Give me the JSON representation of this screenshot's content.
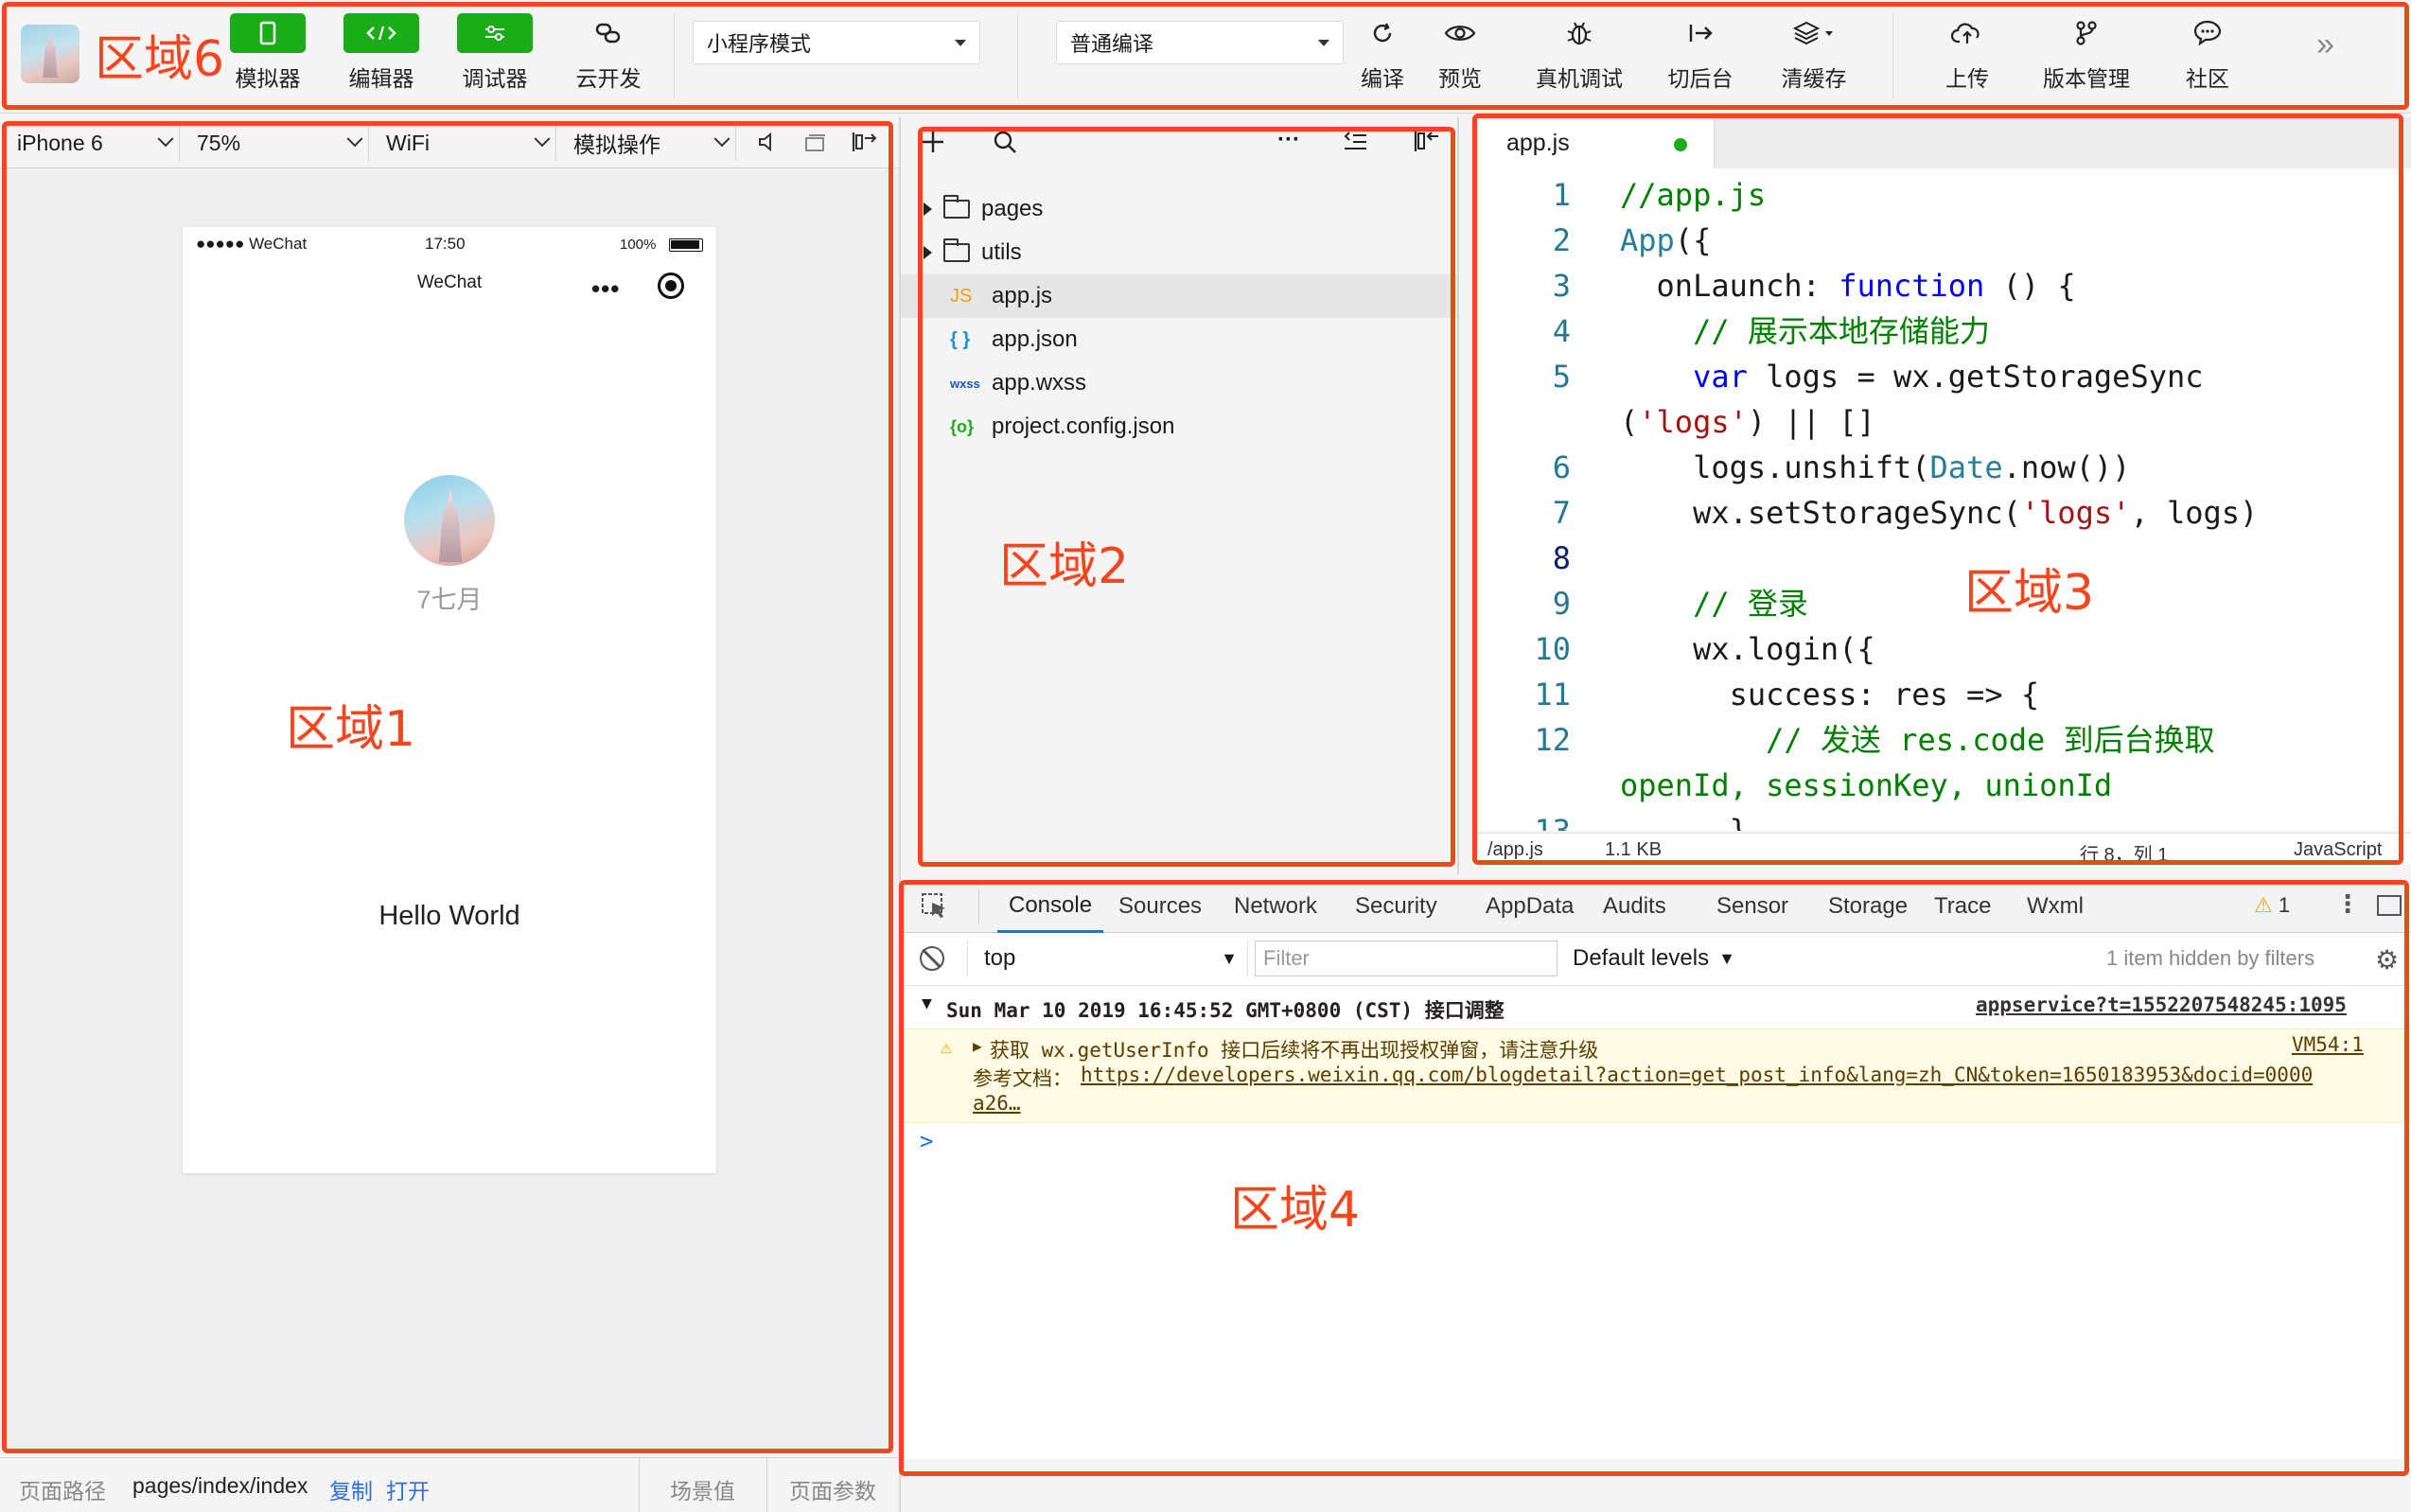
{
  "toolbar": {
    "buttons": [
      {
        "label": "模拟器"
      },
      {
        "label": "编辑器"
      },
      {
        "label": "调试器"
      },
      {
        "label": "云开发"
      }
    ],
    "mode_select": "小程序模式",
    "compile_select": "普通编译",
    "actions": [
      {
        "label": "编译"
      },
      {
        "label": "预览"
      },
      {
        "label": "真机调试"
      },
      {
        "label": "切后台"
      },
      {
        "label": "清缓存"
      },
      {
        "label": "上传"
      },
      {
        "label": "版本管理"
      },
      {
        "label": "社区"
      }
    ],
    "more": "»"
  },
  "simulator": {
    "device": "iPhone 6",
    "zoom": "75%",
    "network": "WiFi",
    "ops": "模拟操作",
    "status_left": "●●●●● WeChat",
    "status_time": "17:50",
    "status_battery": "100%",
    "nav_title": "WeChat",
    "nav_dots": "•••",
    "nickname": "7七月",
    "hello": "Hello World"
  },
  "bottom_bar": {
    "path_label": "页面路径",
    "path": "pages/index/index",
    "copy": "复制",
    "open": "打开",
    "scene": "场景值",
    "params": "页面参数"
  },
  "tree": {
    "items": [
      {
        "type": "folder",
        "name": "pages"
      },
      {
        "type": "folder",
        "name": "utils"
      },
      {
        "type": "JS",
        "name": "app.js",
        "color": "#e8a317"
      },
      {
        "type": "{ }",
        "name": "app.json",
        "color": "#1b8fd8"
      },
      {
        "type": "wxss",
        "name": "app.wxss",
        "color": "#1b55c4"
      },
      {
        "type": "{o}",
        "name": "project.config.json",
        "color": "#1aad19"
      }
    ]
  },
  "editor": {
    "tab": "app.js",
    "status_file": "/app.js",
    "status_size": "1.1 KB",
    "status_pos": "行 8，列 1",
    "status_lang": "JavaScript"
  },
  "devtools": {
    "tabs": [
      "Console",
      "Sources",
      "Network",
      "Security",
      "AppData",
      "Audits",
      "Sensor",
      "Storage",
      "Trace",
      "Wxml"
    ],
    "warn_count": "1",
    "context": "top",
    "filter_placeholder": "Filter",
    "levels": "Default levels",
    "hidden": "1 item hidden by filters",
    "group_title": "Sun Mar 10 2019 16:45:52 GMT+0800 (CST) 接口调整",
    "group_source": "appservice?t=1552207548245:1095",
    "warn_text": "获取 wx.getUserInfo 接口后续将不再出现授权弹窗，请注意升级",
    "warn_source": "VM54:1",
    "doc_label": "参考文档：",
    "doc_url": "https://developers.weixin.qq.com/blogdetail?action=get_post_info&lang=zh_CN&token=1650183953&docid=0000",
    "doc_url2": "a26…",
    "prompt": ">"
  },
  "zones": {
    "z1": "区域1",
    "z2": "区域2",
    "z3": "区域3",
    "z4": "区域4",
    "z6": "区域6"
  },
  "colors": {
    "annotation": "#f4461e",
    "wechat_green": "#1aad19",
    "link_blue": "#1a73e8"
  }
}
